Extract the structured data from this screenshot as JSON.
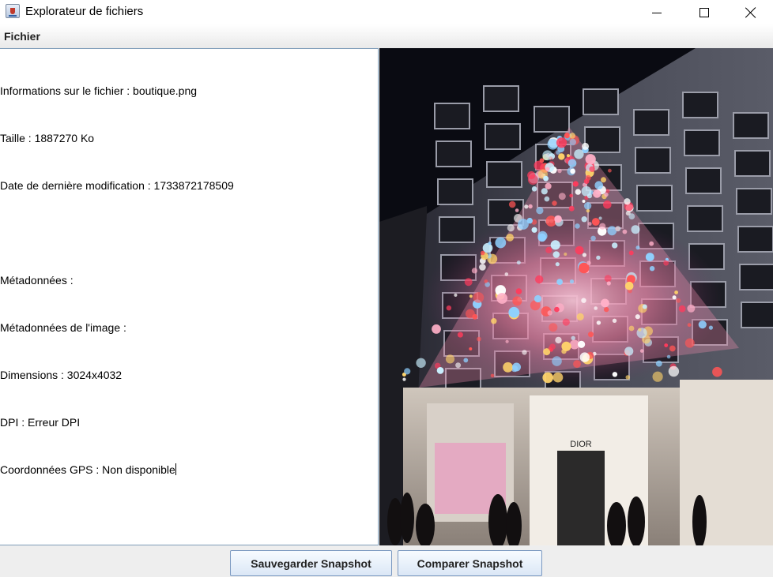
{
  "window": {
    "title": "Explorateur de fichiers",
    "icon": "java-cup-icon"
  },
  "menu": {
    "items": [
      "Fichier"
    ]
  },
  "file_info": {
    "lines": [
      "Informations sur le fichier : boutique.png",
      "Taille : 1887270 Ko",
      "Date de dernière modification : 1733872178509",
      "",
      "Métadonnées :",
      "Métadonnées de l'image :",
      "Dimensions : 3024x4032",
      "DPI : Erreur DPI",
      "Coordonnées GPS : Non disponible"
    ]
  },
  "buttons": {
    "save": "Sauvegarder Snapshot",
    "compare": "Comparer Snapshot"
  },
  "image": {
    "store_sign": "DIOR"
  },
  "colors": {
    "button_border": "#7a98c0",
    "panel_border": "#7f9db9",
    "menubar_bottom": "#e9e9e9"
  }
}
